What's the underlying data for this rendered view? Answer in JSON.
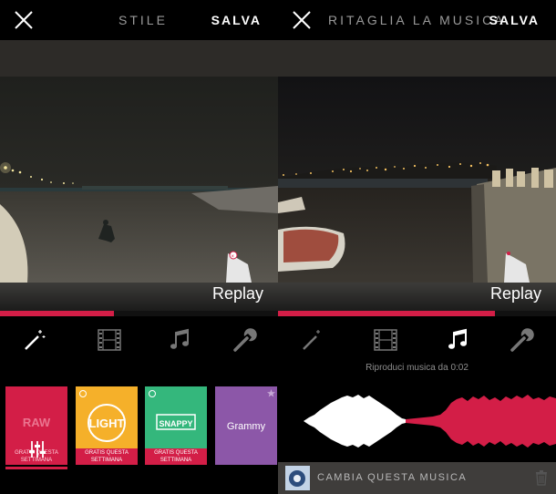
{
  "left": {
    "title": "STILE",
    "save": "SALVA",
    "replay": "Replay",
    "progress": 0.41,
    "active_tool": "style",
    "tools": [
      "magic-wand-icon",
      "film-icon",
      "music-note-icon",
      "wrench-icon"
    ],
    "styles": [
      {
        "name": "RAW",
        "subtitle": "GRATIS QUESTA SETTIMANA",
        "color": "#d31e47",
        "selected": true
      },
      {
        "name": "LIGHT",
        "subtitle": "GRATIS QUESTA SETTIMANA",
        "color": "#f5b02a"
      },
      {
        "name": "SNAPPY",
        "subtitle": "GRATIS QUESTA SETTIMANA",
        "color": "#34b77c"
      },
      {
        "name": "Grammy",
        "subtitle": "",
        "color": "#8c57a8"
      }
    ]
  },
  "right": {
    "title": "RITAGLIA LA MUSICA",
    "save": "SALVA",
    "replay": "Replay",
    "progress": 0.78,
    "active_tool": "music",
    "caption": "Riproduci musica da 0:02",
    "music_action": "CAMBIA QUESTA MUSICA",
    "colors": {
      "accent": "#d31e47",
      "waveform_played": "#ffffff",
      "waveform_rest": "#d31e47"
    }
  }
}
